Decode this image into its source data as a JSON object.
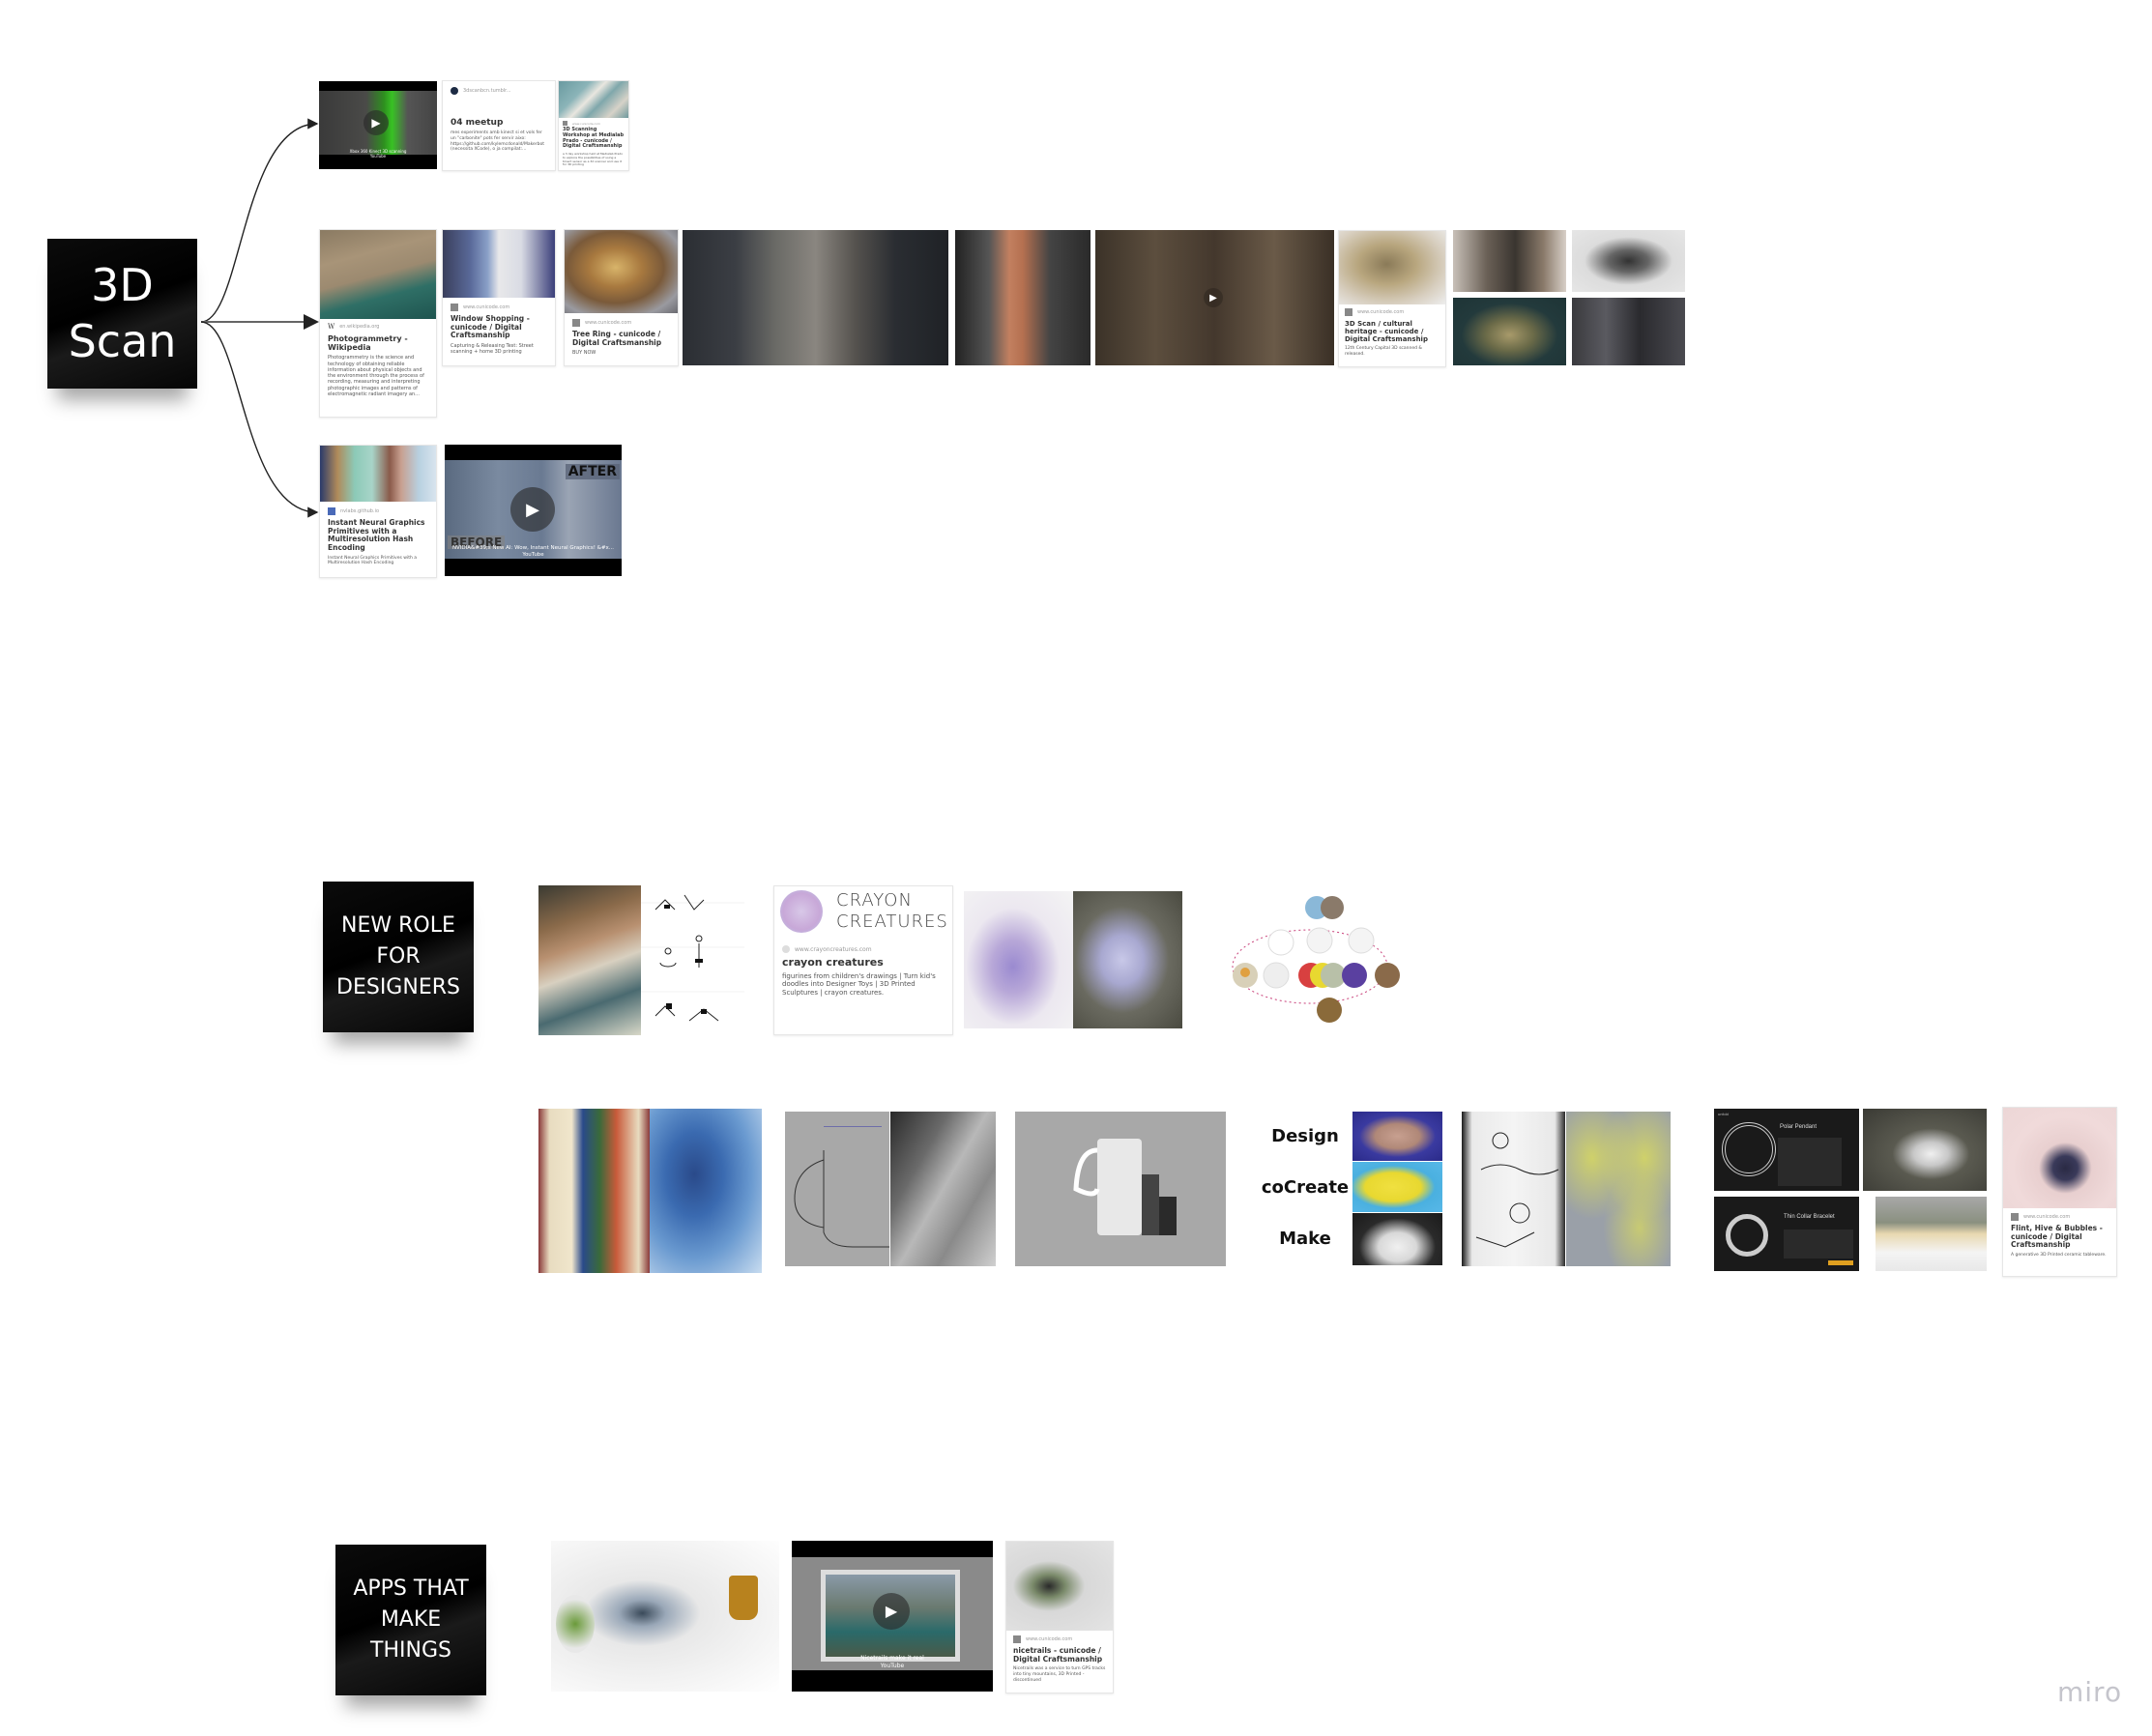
{
  "board": {
    "logo": "miro"
  },
  "sections": {
    "scan": {
      "sticky_lines": [
        "3D",
        "Scan"
      ],
      "row1": {
        "video1": {
          "caption": "Xbox 360 Kinect 3D scanning",
          "source": "YouTube"
        },
        "card_meetup": {
          "site": "3dscanbcn.tumblr...",
          "title": "04 meetup",
          "desc": "mes experiments amb kinect si et vols fer un \"carbonite\" pots fer servir aixo: https://github.com/kylemcdonald/Makerbot (necessita XCode), o ja compilat:..."
        },
        "card_workshop": {
          "site": "www.cunicode.com",
          "title": "3D Scanning Workshop at Medialab Prado - cunicode / Digital Craftsmanship",
          "desc": "a 3 day workshop held at Medialab Prado to explore the possibilities of using a Kinect sensor as a 3d scanner and use it for 3D printing"
        }
      },
      "row2": {
        "card_wiki": {
          "site": "en.wikipedia.org",
          "title": "Photogrammetry - Wikipedia",
          "desc": "Photogrammetry is the science and technology of obtaining reliable information about physical objects and the environment through the process of recording, measuring and interpreting photographic images and patterns of electromagnetic radiant imagery an..."
        },
        "card_window": {
          "site": "www.cunicode.com",
          "title": "Window Shopping - cunicode / Digital Craftsmanship",
          "desc": "Capturing & Releasing Test: Street scanning + home 3D printing"
        },
        "card_treering": {
          "site": "www.cunicode.com",
          "title": "Tree Ring - cunicode / Digital Craftsmanship",
          "desc": "BUY NOW"
        },
        "card_heritage": {
          "site": "www.cunicode.com",
          "title": "3D Scan / cultural heritage - cunicode / Digital Craftsmanship",
          "desc": "12th Century Capital 3D scanned & released."
        }
      },
      "row3": {
        "card_nerf": {
          "site": "nvlabs.github.io",
          "title": "Instant Neural Graphics Primitives with a Multiresolution Hash Encoding",
          "desc": "Instant Neural Graphics Primitives with a Multiresolution Hash Encoding"
        },
        "video_nerf": {
          "caption": "NVIDIA&#39;s New AI: Wow, Instant Neural Graphics! &#x...",
          "source": "YouTube",
          "after": "AFTER",
          "before": "BEFORE"
        }
      }
    },
    "designers": {
      "sticky_lines": [
        "NEW ROLE",
        "FOR",
        "DESIGNERS"
      ],
      "card_crayon": {
        "logo_line1": "CRAYON",
        "logo_line2": "CREATURES",
        "site": "www.crayoncreatures.com",
        "title": "crayon creatures",
        "desc": "figurines from children's drawings | Turn kid's doodles into Designer Toys | 3D Printed Sculptures | crayon creatures."
      },
      "dcm_labels": [
        "Design",
        "coCreate",
        "Make"
      ],
      "card_flint": {
        "site": "www.cunicode.com",
        "title": "Flint, Hive & Bubbles - cunicode / Digital Craftsmanship",
        "desc": "A generative 3D Printed ceramic tableware."
      },
      "screens": {
        "pendant_title": "Polar Pendant",
        "bracelet_title": "Thin Collar Bracelet",
        "brand": "unfold"
      }
    },
    "apps": {
      "sticky_lines": [
        "APPS THAT",
        "MAKE",
        "THINGS"
      ],
      "video_nicetrails": {
        "caption": "Nicetrails make it real",
        "source": "YouTube"
      },
      "card_nicetrails": {
        "site": "www.cunicode.com",
        "title": "nicetrails - cunicode / Digital Craftsmanship",
        "desc": "Nicetrails was a service to turn GPS tracks into tiny mountains, 3D Printed - discontinued"
      }
    }
  }
}
